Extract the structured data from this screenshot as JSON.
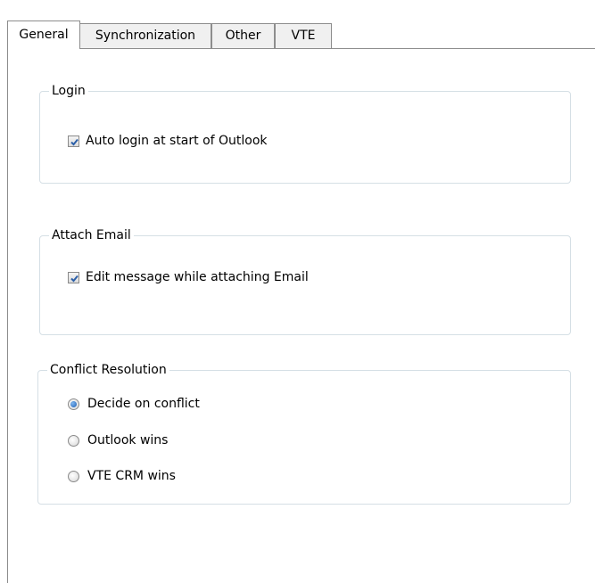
{
  "tabs": [
    {
      "label": "General",
      "active": true
    },
    {
      "label": "Synchronization",
      "active": false
    },
    {
      "label": "Other",
      "active": false
    },
    {
      "label": "VTE",
      "active": false
    }
  ],
  "login": {
    "title": "Login",
    "auto_login_label": "Auto login at start of Outlook",
    "auto_login_checked": true
  },
  "attach_email": {
    "title": "Attach Email",
    "edit_message_label": "Edit message while attaching Email",
    "edit_message_checked": true
  },
  "conflict_resolution": {
    "title": "Conflict Resolution",
    "options": [
      {
        "label": "Decide on conflict",
        "selected": true
      },
      {
        "label": "Outlook wins",
        "selected": false
      },
      {
        "label": "VTE CRM wins",
        "selected": false
      }
    ]
  },
  "colors": {
    "check_mark": "#2b5fa8",
    "radio_selected": "#1c5fb5",
    "group_border": "#d5dfe5"
  },
  "icons": {
    "checked": "checkbox-checked-icon",
    "radio_on": "radio-selected-icon",
    "radio_off": "radio-unselected-icon"
  }
}
